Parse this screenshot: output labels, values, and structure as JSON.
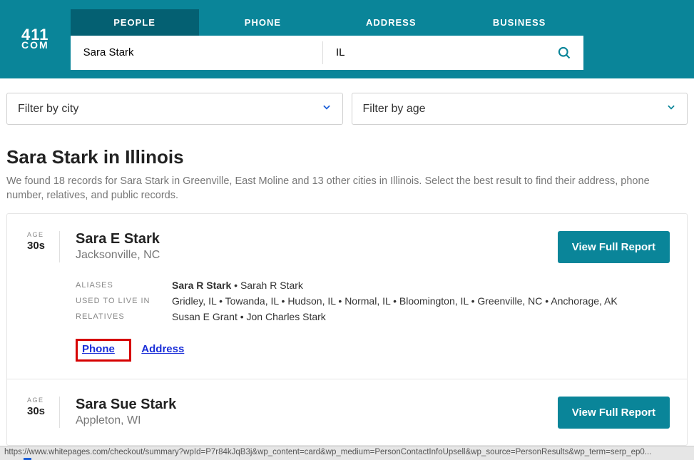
{
  "logo": {
    "top": "411",
    "bottom": "COM"
  },
  "tabs": {
    "people": "PEOPLE",
    "phone": "PHONE",
    "address": "ADDRESS",
    "business": "BUSINESS"
  },
  "search": {
    "name": "Sara Stark",
    "state": "IL"
  },
  "filters": {
    "city": "Filter by city",
    "age": "Filter by age"
  },
  "title": "Sara Stark in Illinois",
  "subtitle": "We found 18 records for Sara Stark in Greenville, East Moline and 13 other cities in Illinois. Select the best result to find their address, phone number, relatives, and public records.",
  "labels": {
    "age": "AGE",
    "aliases": "ALIASES",
    "used_to_live": "USED TO LIVE IN",
    "relatives": "RELATIVES"
  },
  "results": [
    {
      "age": "30s",
      "name": "Sara E Stark",
      "location": "Jacksonville, NC",
      "aliases_bold": "Sara R Stark",
      "aliases_rest": " • Sarah R Stark",
      "lived": "Gridley, IL • Towanda, IL • Hudson, IL • Normal, IL • Bloomington, IL • Greenville, NC • Anchorage, AK",
      "relatives": "Susan E Grant • Jon Charles Stark",
      "phone_link": "Phone",
      "address_link": "Address",
      "report": "View Full Report"
    },
    {
      "age": "30s",
      "name": "Sara Sue Stark",
      "location": "Appleton, WI",
      "report": "View Full Report"
    }
  ],
  "status_url": "https://www.whitepages.com/checkout/summary?wpId=P7r84kJqB3j&wp_content=card&wp_medium=PersonContactInfoUpsell&wp_source=PersonResults&wp_term=serp_ep0..."
}
